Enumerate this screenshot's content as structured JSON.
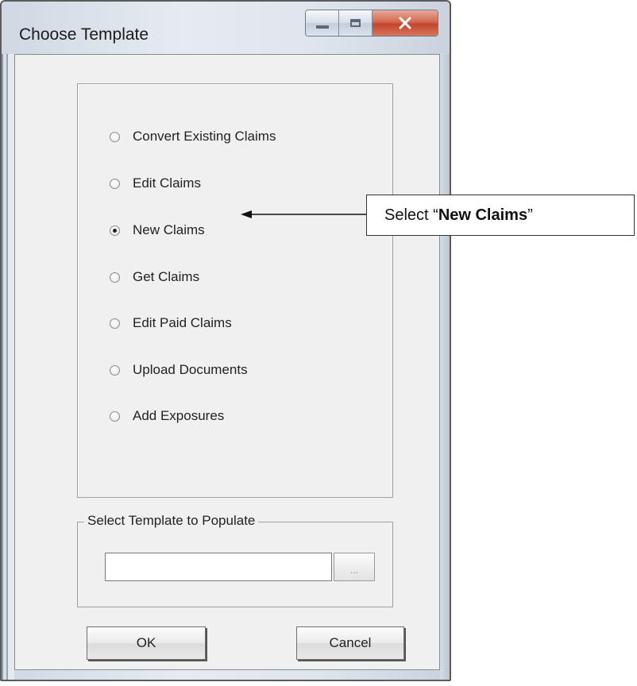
{
  "window": {
    "title": "Choose Template",
    "close_symbol": "X"
  },
  "options": [
    {
      "label": "Convert Existing Claims",
      "selected": false
    },
    {
      "label": "Edit Claims",
      "selected": false
    },
    {
      "label": "New Claims",
      "selected": true
    },
    {
      "label": "Get Claims",
      "selected": false
    },
    {
      "label": "Edit Paid Claims",
      "selected": false
    },
    {
      "label": "Upload Documents",
      "selected": false
    },
    {
      "label": "Add Exposures",
      "selected": false
    }
  ],
  "template_group": {
    "legend": "Select Template to Populate",
    "input_value": "",
    "browse_label": "..."
  },
  "buttons": {
    "ok": "OK",
    "cancel": "Cancel"
  },
  "callout": {
    "prefix": "Select “",
    "bold": "New Claims",
    "suffix": "”"
  }
}
